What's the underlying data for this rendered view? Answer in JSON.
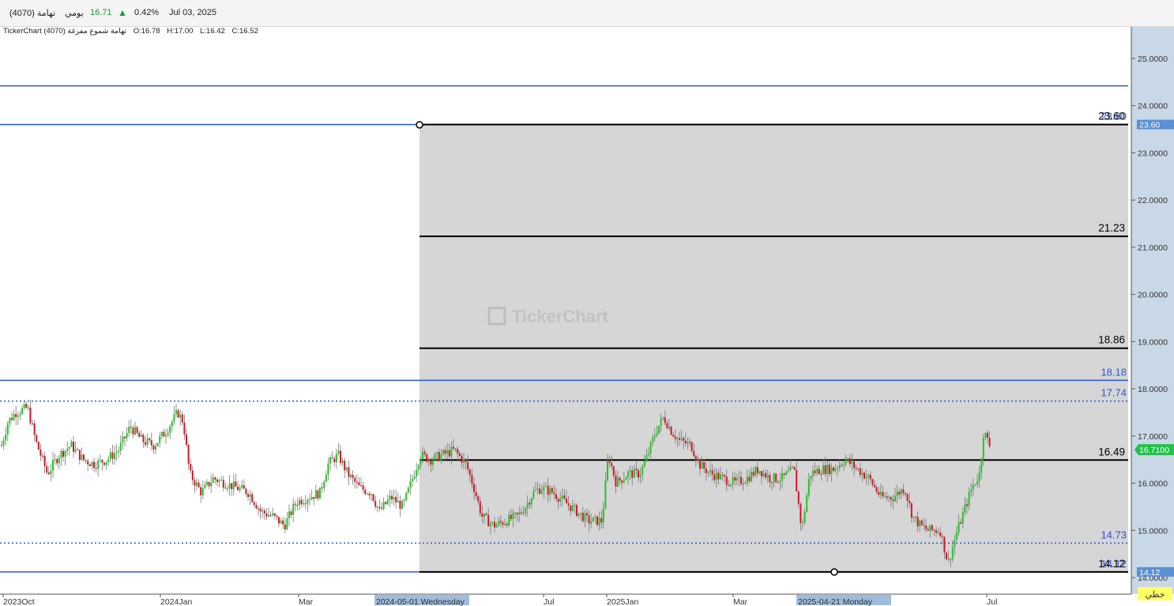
{
  "header": {
    "symbol": "(4070) تهامة",
    "period": "يومي",
    "last_price": "16.71",
    "change_pct": "0.42%",
    "date": "Jul 03, 2025"
  },
  "ohlc_bar": {
    "source": "TickerChart (4070) تهامة شموع مفرغة",
    "open": "O:16.78",
    "high": "H:17.00",
    "low": "L:16.42",
    "close": "C:16.52"
  },
  "watermark": "TickerChart",
  "colors": {
    "up": "#1fc71f",
    "down": "#d4142a",
    "h_line": "#2957d6",
    "fib": "#000000",
    "fib_fill": "#d6d6d6",
    "up_arrow": "#1a9a3a"
  },
  "chart_data": {
    "type": "candlestick",
    "y_axis": {
      "min": 14.0,
      "max": 25.0,
      "ticks": [
        "25.0000",
        "24.0000",
        "23.0000",
        "22.0000",
        "21.0000",
        "20.0000",
        "19.0000",
        "18.0000",
        "17.0000",
        "16.0000",
        "15.0000",
        "14.0000"
      ]
    },
    "x_labels": [
      "2023Oct",
      "2024Jan",
      "Mar",
      "2024-05-01 Wednesday",
      "Jul",
      "2025Jan",
      "Mar",
      "2025-04-21 Monday",
      "Jul"
    ],
    "fib_levels": [
      {
        "value": 23.6,
        "label": "23.60"
      },
      {
        "value": 21.23,
        "label": "21.23"
      },
      {
        "value": 18.86,
        "label": "18.86"
      },
      {
        "value": 16.49,
        "label": "16.49"
      },
      {
        "value": 14.12,
        "label": "14.12"
      }
    ],
    "horizontal_lines": [
      {
        "value": 24.42,
        "style": "solid",
        "label": ""
      },
      {
        "value": 23.6,
        "style": "solid",
        "label": "23.60"
      },
      {
        "value": 18.18,
        "style": "solid",
        "label": "18.18"
      },
      {
        "value": 17.74,
        "style": "dotted",
        "label": "17.74"
      },
      {
        "value": 14.73,
        "style": "dotted",
        "label": "14.73"
      },
      {
        "value": 14.12,
        "style": "solid",
        "label": "14.12"
      }
    ],
    "price_tags": [
      {
        "value": 23.6,
        "label": "23.60"
      },
      {
        "value": 16.71,
        "label": "16.7100"
      },
      {
        "value": 14.12,
        "label": "14.12"
      }
    ],
    "linear_label": "خطي",
    "series_anchors": [
      [
        2,
        16.8
      ],
      [
        10,
        17.3
      ],
      [
        20,
        17.5
      ],
      [
        35,
        17.6
      ],
      [
        45,
        16.9
      ],
      [
        60,
        16.2
      ],
      [
        75,
        16.6
      ],
      [
        90,
        16.8
      ],
      [
        105,
        16.5
      ],
      [
        120,
        16.4
      ],
      [
        135,
        16.5
      ],
      [
        150,
        16.7
      ],
      [
        165,
        17.2
      ],
      [
        180,
        16.9
      ],
      [
        195,
        16.8
      ],
      [
        210,
        17.1
      ],
      [
        225,
        17.5
      ],
      [
        232,
        17.3
      ],
      [
        240,
        16.2
      ],
      [
        255,
        15.8
      ],
      [
        270,
        16.1
      ],
      [
        285,
        16.0
      ],
      [
        300,
        15.9
      ],
      [
        315,
        15.8
      ],
      [
        330,
        15.4
      ],
      [
        345,
        15.3
      ],
      [
        360,
        15.1
      ],
      [
        375,
        15.6
      ],
      [
        390,
        15.7
      ],
      [
        405,
        15.8
      ],
      [
        415,
        16.4
      ],
      [
        428,
        16.6
      ],
      [
        440,
        16.2
      ],
      [
        455,
        15.9
      ],
      [
        470,
        15.8
      ],
      [
        480,
        15.4
      ],
      [
        495,
        15.7
      ],
      [
        510,
        15.5
      ],
      [
        520,
        16.0
      ],
      [
        532,
        16.6
      ],
      [
        545,
        16.5
      ],
      [
        560,
        16.6
      ],
      [
        575,
        16.7
      ],
      [
        590,
        16.4
      ],
      [
        600,
        15.9
      ],
      [
        610,
        15.3
      ],
      [
        625,
        15.1
      ],
      [
        640,
        15.2
      ],
      [
        655,
        15.3
      ],
      [
        665,
        15.5
      ],
      [
        675,
        15.8
      ],
      [
        685,
        15.9
      ],
      [
        700,
        15.8
      ],
      [
        715,
        15.6
      ],
      [
        730,
        15.4
      ],
      [
        745,
        15.2
      ],
      [
        762,
        15.2
      ],
      [
        770,
        16.6
      ],
      [
        780,
        16.0
      ],
      [
        795,
        16.2
      ],
      [
        810,
        16.2
      ],
      [
        820,
        16.6
      ],
      [
        830,
        17.1
      ],
      [
        840,
        17.4
      ],
      [
        850,
        17.1
      ],
      [
        860,
        16.9
      ],
      [
        875,
        16.8
      ],
      [
        885,
        16.4
      ],
      [
        900,
        16.2
      ],
      [
        915,
        16.1
      ],
      [
        930,
        16.0
      ],
      [
        945,
        16.1
      ],
      [
        960,
        16.3
      ],
      [
        975,
        16.1
      ],
      [
        990,
        16.1
      ],
      [
        1005,
        16.3
      ],
      [
        1015,
        15.0
      ],
      [
        1025,
        16.2
      ],
      [
        1040,
        16.3
      ],
      [
        1055,
        16.3
      ],
      [
        1070,
        16.5
      ],
      [
        1085,
        16.3
      ],
      [
        1100,
        16.1
      ],
      [
        1115,
        15.7
      ],
      [
        1130,
        15.7
      ],
      [
        1145,
        15.9
      ],
      [
        1155,
        15.3
      ],
      [
        1165,
        15.1
      ],
      [
        1175,
        15.0
      ],
      [
        1190,
        15.0
      ],
      [
        1200,
        14.3
      ],
      [
        1210,
        14.9
      ],
      [
        1220,
        15.4
      ],
      [
        1230,
        15.9
      ],
      [
        1240,
        16.2
      ],
      [
        1245,
        17.1
      ],
      [
        1255,
        16.71
      ]
    ]
  }
}
